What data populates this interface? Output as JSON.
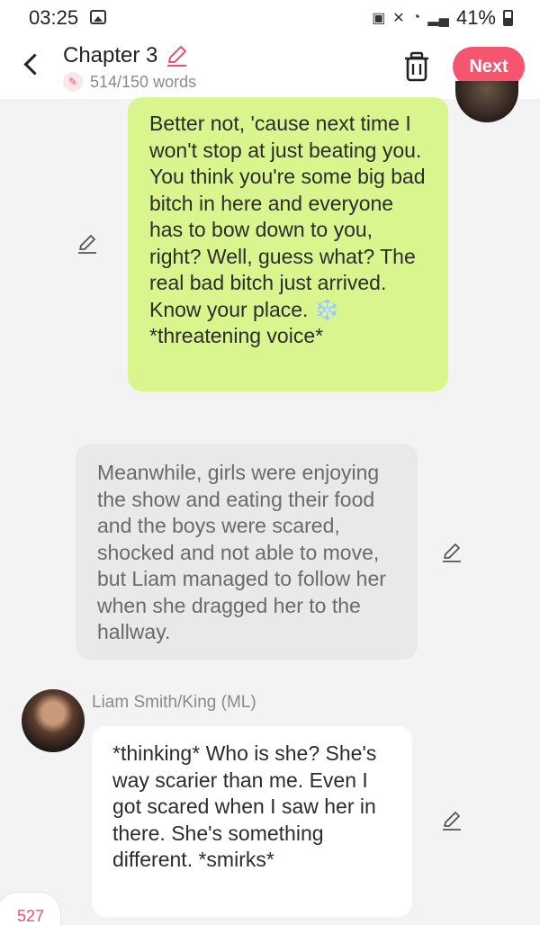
{
  "status": {
    "time": "03:25",
    "battery": "41%",
    "icons": [
      "photo-icon",
      "battery-saver-icon",
      "mute-icon",
      "wifi-icon",
      "signal-icon",
      "battery-icon"
    ]
  },
  "header": {
    "title": "Chapter 3",
    "word_count": "514/150 words",
    "next_label": "Next"
  },
  "messages": [
    {
      "style": "green",
      "text": "Better not, 'cause next time I won't stop at just beating you. You think you're some big bad bitch in here and everyone has to bow down to you, right? Well, guess what? The real bad bitch just arrived. Know your place. ❄️ *threatening voice*"
    },
    {
      "style": "gray",
      "text": "Meanwhile, girls were enjoying the show and eating their food and the boys were scared, shocked and not able to move, but Liam managed to follow her when she dragged her to the hallway."
    },
    {
      "style": "white",
      "speaker": "Liam Smith/King (ML)",
      "text": "*thinking* Who is she? She's way scarier than me. Even I got scared when I saw her in there. She's something different. *smirks*"
    }
  ],
  "bottom_counter": "527",
  "colors": {
    "accent": "#f5556e",
    "green_bubble": "#d9f58e",
    "gray_bubble": "#e9e9e9",
    "background": "#f3f3f3"
  }
}
